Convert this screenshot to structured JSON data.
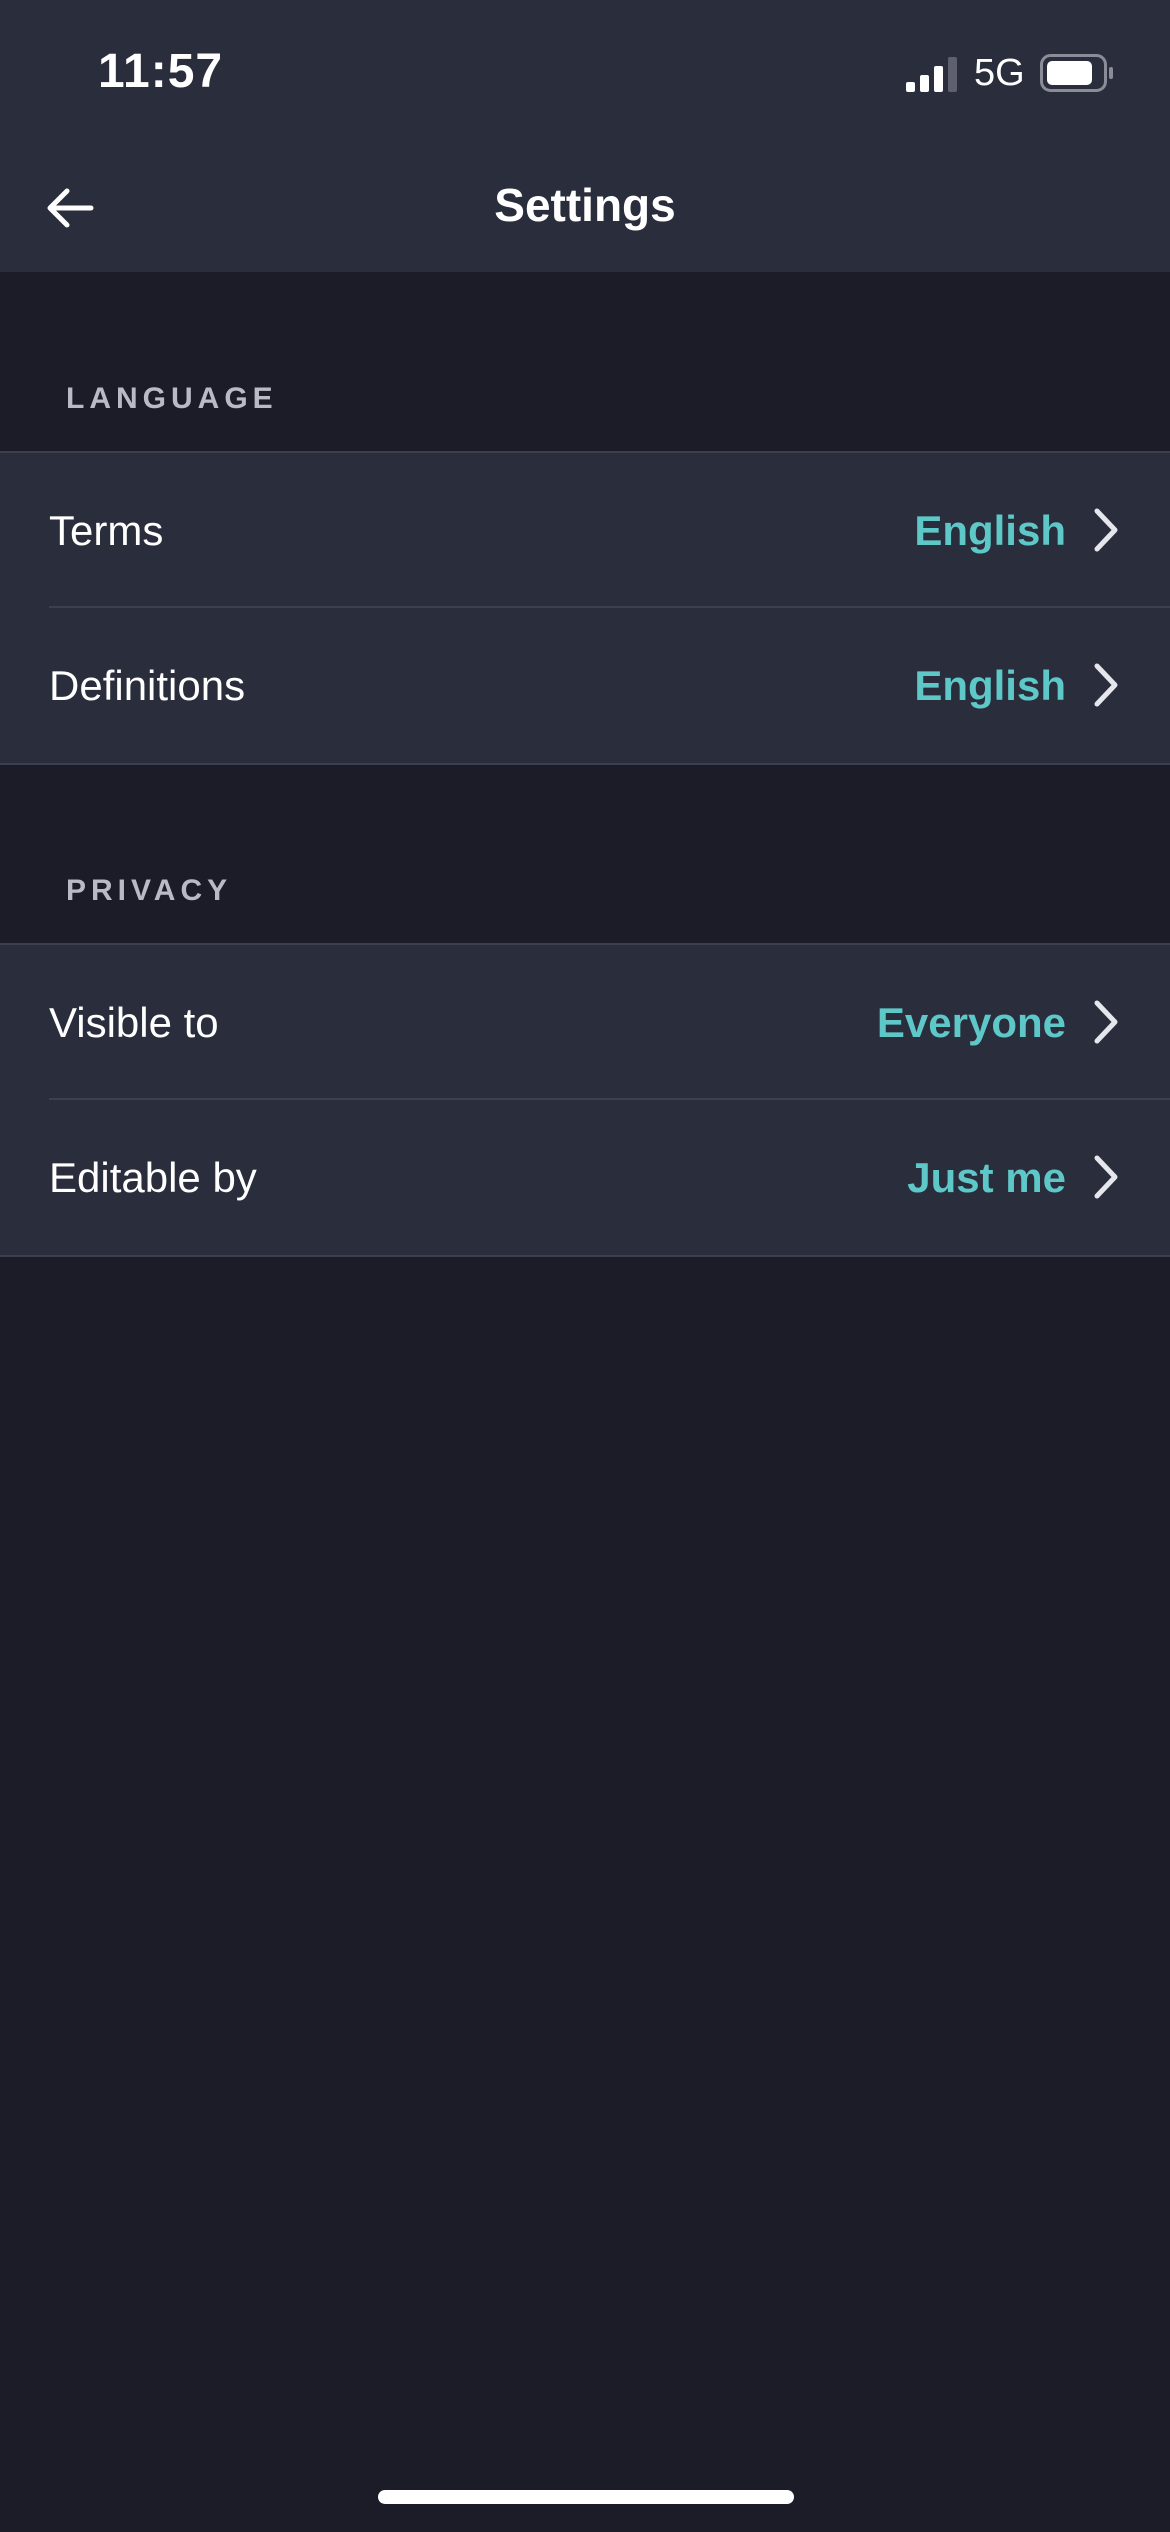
{
  "status_bar": {
    "time": "11:57",
    "network": "5G",
    "signal_icon": "signal-bars-icon",
    "battery_icon": "battery-icon"
  },
  "header": {
    "title": "Settings",
    "back_icon": "arrow-left-icon"
  },
  "sections": [
    {
      "title": "LANGUAGE",
      "rows": [
        {
          "label": "Terms",
          "value": "English"
        },
        {
          "label": "Definitions",
          "value": "English"
        }
      ]
    },
    {
      "title": "PRIVACY",
      "rows": [
        {
          "label": "Visible to",
          "value": "Everyone"
        },
        {
          "label": "Editable by",
          "value": "Just me"
        }
      ]
    }
  ],
  "colors": {
    "background": "#1b1c27",
    "surface": "#2a2d3c",
    "accent": "#5ec7c7",
    "section_label": "#b8bac6"
  }
}
